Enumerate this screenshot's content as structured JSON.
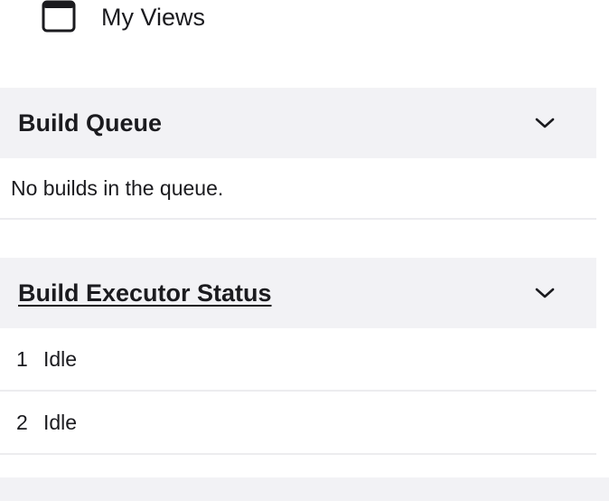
{
  "nav": {
    "my_views_label": "My Views",
    "my_views_icon": "window-icon"
  },
  "build_queue": {
    "title": "Build Queue",
    "toggle_icon": "chevron-down-icon",
    "empty_message": "No builds in the queue."
  },
  "executor_status": {
    "title": "Build Executor Status",
    "toggle_icon": "chevron-down-icon",
    "executors": [
      {
        "number": "1",
        "status": "Idle"
      },
      {
        "number": "2",
        "status": "Idle"
      }
    ]
  },
  "colors": {
    "header_bg": "#f2f2f5",
    "text": "#1b1b1f",
    "divider": "#ececef"
  }
}
